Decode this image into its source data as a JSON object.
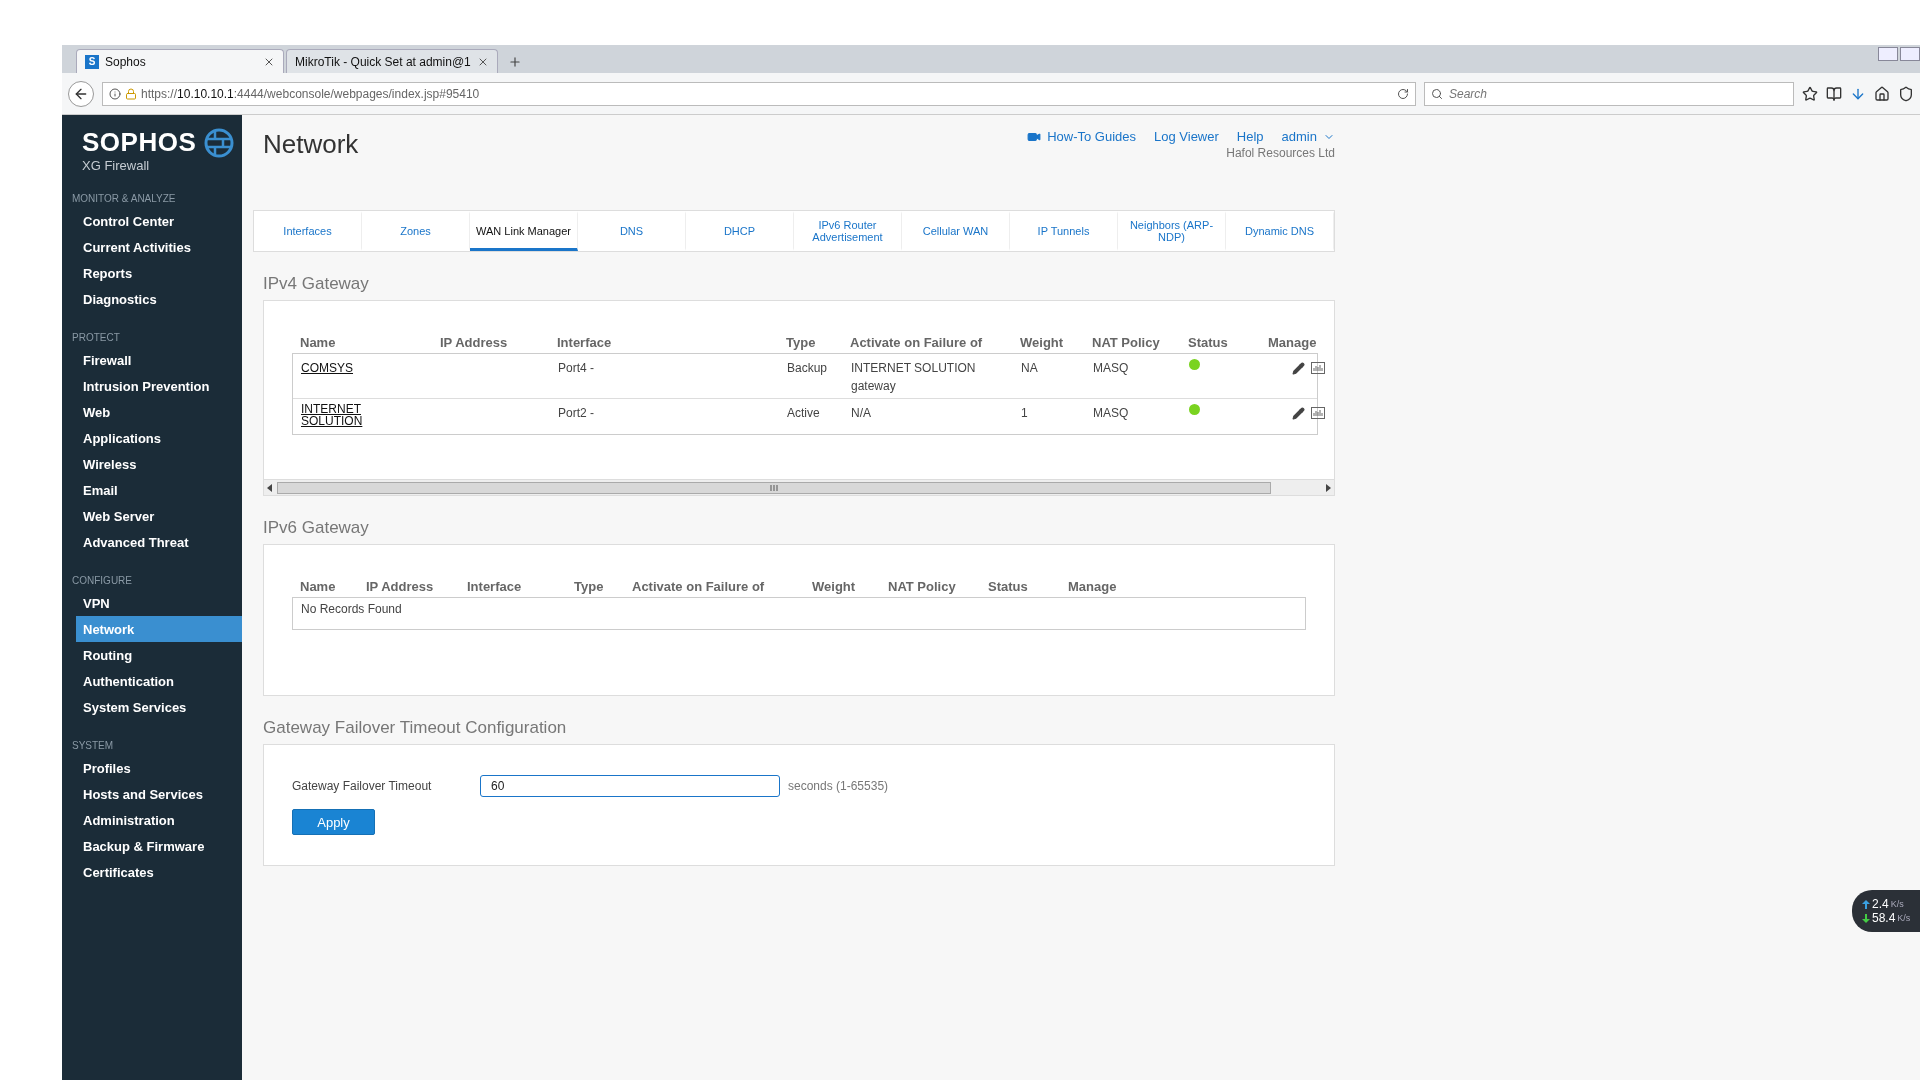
{
  "browser": {
    "tabs": [
      {
        "icon_letter": "S",
        "title": "Sophos",
        "selected": true
      },
      {
        "title": "MikroTik - Quick Set at admin@1",
        "selected": false
      }
    ],
    "url": {
      "prefix": "https://",
      "host": "10.10.10.1",
      "rest": ":4444/webconsole/webpages/index.jsp#95410"
    },
    "search": {
      "placeholder": "Search"
    }
  },
  "sidebar": {
    "logo": "SOPHOS",
    "product": "XG Firewall",
    "sections": [
      {
        "heading": "MONITOR & ANALYZE",
        "items": [
          {
            "label": "Control Center",
            "selected": false
          },
          {
            "label": "Current Activities",
            "selected": false
          },
          {
            "label": "Reports",
            "selected": false
          },
          {
            "label": "Diagnostics",
            "selected": false
          }
        ]
      },
      {
        "heading": "PROTECT",
        "items": [
          {
            "label": "Firewall",
            "selected": false
          },
          {
            "label": "Intrusion Prevention",
            "selected": false
          },
          {
            "label": "Web",
            "selected": false
          },
          {
            "label": "Applications",
            "selected": false
          },
          {
            "label": "Wireless",
            "selected": false
          },
          {
            "label": "Email",
            "selected": false
          },
          {
            "label": "Web Server",
            "selected": false
          },
          {
            "label": "Advanced Threat",
            "selected": false
          }
        ]
      },
      {
        "heading": "CONFIGURE",
        "items": [
          {
            "label": "VPN",
            "selected": false
          },
          {
            "label": "Network",
            "selected": true
          },
          {
            "label": "Routing",
            "selected": false
          },
          {
            "label": "Authentication",
            "selected": false
          },
          {
            "label": "System Services",
            "selected": false
          }
        ]
      },
      {
        "heading": "SYSTEM",
        "items": [
          {
            "label": "Profiles",
            "selected": false
          },
          {
            "label": "Hosts and Services",
            "selected": false
          },
          {
            "label": "Administration",
            "selected": false
          },
          {
            "label": "Backup & Firmware",
            "selected": false
          },
          {
            "label": "Certificates",
            "selected": false
          }
        ]
      }
    ]
  },
  "header": {
    "title": "Network",
    "links": [
      "How-To Guides",
      "Log Viewer",
      "Help"
    ],
    "user": "admin",
    "organization": "Hafol Resources Ltd"
  },
  "tabs": [
    {
      "label": "Interfaces",
      "selected": false
    },
    {
      "label": "Zones",
      "selected": false
    },
    {
      "label": "WAN Link Manager",
      "selected": true
    },
    {
      "label": "DNS",
      "selected": false
    },
    {
      "label": "DHCP",
      "selected": false
    },
    {
      "label": "IPv6 Router Advertisement",
      "selected": false
    },
    {
      "label": "Cellular WAN",
      "selected": false
    },
    {
      "label": "IP Tunnels",
      "selected": false
    },
    {
      "label": "Neighbors (ARP-NDP)",
      "selected": false
    },
    {
      "label": "Dynamic DNS",
      "selected": false
    }
  ],
  "ipv4": {
    "title": "IPv4 Gateway",
    "columns": [
      "Name",
      "IP Address",
      "Interface",
      "Type",
      "Activate on Failure of",
      "Weight",
      "NAT Policy",
      "Status",
      "Manage"
    ],
    "rows": [
      {
        "name": "COMSYS",
        "interface": "Port4 -",
        "type": "Backup",
        "activate_on_failure": "INTERNET SOLUTION gateway",
        "weight": "NA",
        "nat_policy": "MASQ",
        "color": "#7ad320"
      },
      {
        "name": "INTERNET SOLUTION",
        "interface": "Port2 -",
        "type": "Active",
        "activate_on_failure": "N/A",
        "weight": "1",
        "nat_policy": "MASQ",
        "color": "#7ad320"
      }
    ]
  },
  "ipv6": {
    "title": "IPv6 Gateway",
    "columns": [
      "Name",
      "IP Address",
      "Interface",
      "Type",
      "Activate on Failure of",
      "Weight",
      "NAT Policy",
      "Status",
      "Manage"
    ],
    "empty_text": "No Records Found"
  },
  "failover": {
    "title": "Gateway Failover Timeout Configuration",
    "label": "Gateway Failover Timeout",
    "value": "60",
    "hint": "seconds (1-65535)",
    "button": "Apply"
  },
  "speed": {
    "up": {
      "value": "2.4",
      "unit": "K/s"
    },
    "down": {
      "value": "58.4",
      "unit": "K/s"
    }
  }
}
